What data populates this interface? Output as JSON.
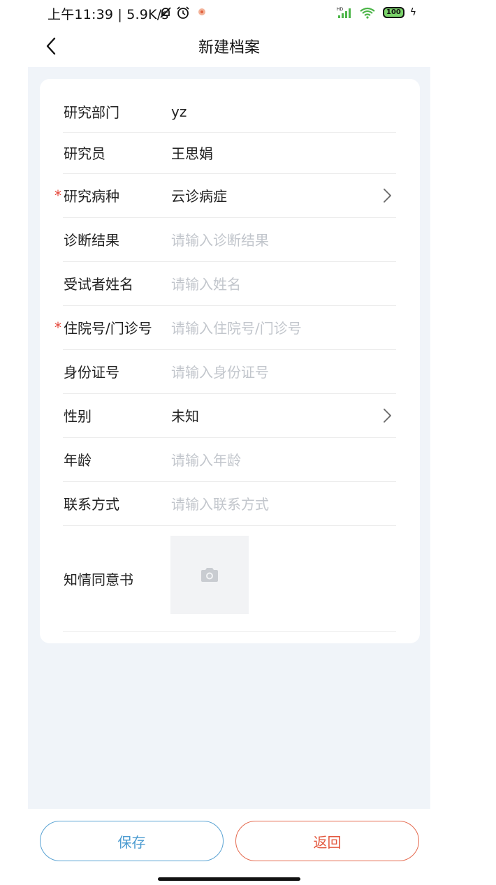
{
  "status_bar": {
    "text": "上午11:39 | 5.9K/s",
    "battery": "100",
    "icons": [
      "mute-bell-icon",
      "alarm-icon",
      "app-notification-icon",
      "hd-signal-icon",
      "wifi-icon",
      "battery-icon",
      "charging-bolt-icon"
    ]
  },
  "nav": {
    "title": "新建档案",
    "back_icon": "chevron-left-icon"
  },
  "form": {
    "rows": [
      {
        "label": "研究部门",
        "value": "yz",
        "required": false,
        "placeholder": false,
        "chevron": false
      },
      {
        "label": "研究员",
        "value": "王思娟",
        "required": false,
        "placeholder": false,
        "chevron": false
      },
      {
        "label": "研究病种",
        "value": "云诊病症",
        "required": true,
        "placeholder": false,
        "chevron": true
      },
      {
        "label": "诊断结果",
        "value": "请输入诊断结果",
        "required": false,
        "placeholder": true,
        "chevron": false
      },
      {
        "label": "受试者姓名",
        "value": "请输入姓名",
        "required": false,
        "placeholder": true,
        "chevron": false
      },
      {
        "label": "住院号/门诊号",
        "value": "请输入住院号/门诊号",
        "required": true,
        "placeholder": true,
        "chevron": false
      },
      {
        "label": "身份证号",
        "value": "请输入身份证号",
        "required": false,
        "placeholder": true,
        "chevron": false
      },
      {
        "label": "性别",
        "value": "未知",
        "required": false,
        "placeholder": false,
        "chevron": true
      },
      {
        "label": "年龄",
        "value": "请输入年龄",
        "required": false,
        "placeholder": true,
        "chevron": false
      },
      {
        "label": "联系方式",
        "value": "请输入联系方式",
        "required": false,
        "placeholder": true,
        "chevron": false
      }
    ],
    "required_mark": "*",
    "consent_label": "知情同意书",
    "upload_icon": "camera-icon"
  },
  "buttons": {
    "save": "保存",
    "back": "返回"
  },
  "colors": {
    "page_bg": "#f0f4f9",
    "required": "#e5483c",
    "save": "#4b9bd0",
    "back": "#e3573d",
    "placeholder": "#c2c6cc"
  }
}
